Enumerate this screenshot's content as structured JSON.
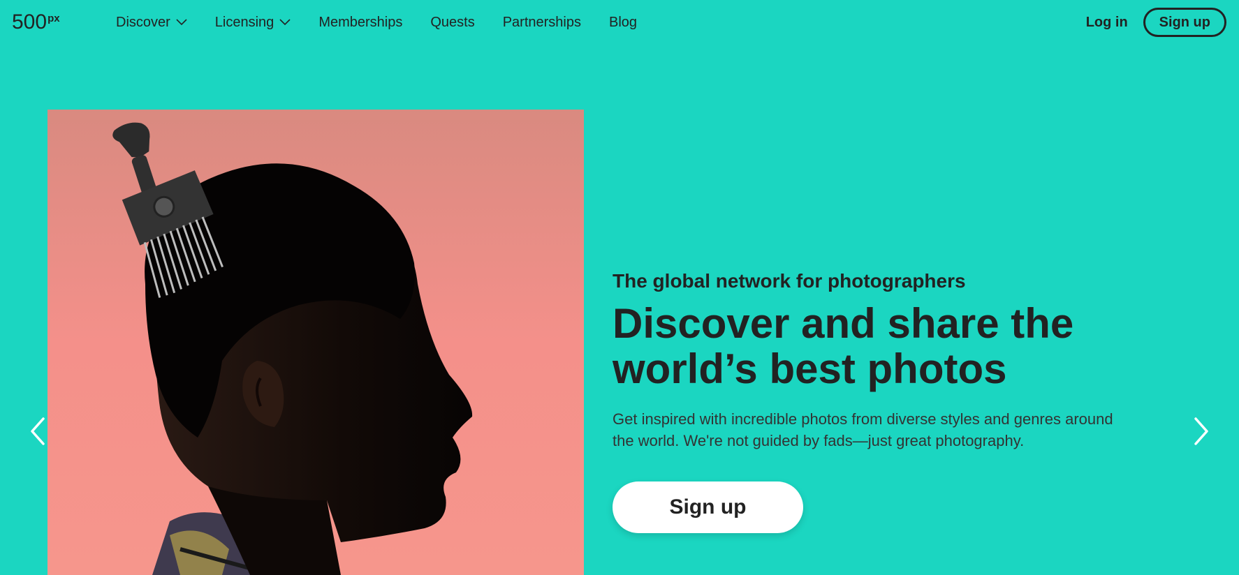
{
  "colors": {
    "background": "#1bd6c1",
    "text": "#222222",
    "button_bg": "#ffffff",
    "photo_bg": "#f4908a"
  },
  "header": {
    "logo": {
      "main": "500",
      "sup": "px"
    },
    "nav": [
      {
        "label": "Discover",
        "has_dropdown": true
      },
      {
        "label": "Licensing",
        "has_dropdown": true
      },
      {
        "label": "Memberships",
        "has_dropdown": false
      },
      {
        "label": "Quests",
        "has_dropdown": false
      },
      {
        "label": "Partnerships",
        "has_dropdown": false
      },
      {
        "label": "Blog",
        "has_dropdown": false
      }
    ],
    "login_label": "Log in",
    "signup_label": "Sign up"
  },
  "hero": {
    "eyebrow": "The global network for photographers",
    "headline_line1": "Discover and share the",
    "headline_line2": "world’s best photos",
    "lede_line1": "Get inspired with incredible photos from diverse styles and genres around",
    "lede_line2": "the world. We're not guided by fads—just great photography.",
    "cta_label": "Sign up"
  },
  "carousel": {
    "prev_icon": "chevron-left-icon",
    "next_icon": "chevron-right-icon",
    "image_subject": "profile portrait with afro pick comb"
  }
}
